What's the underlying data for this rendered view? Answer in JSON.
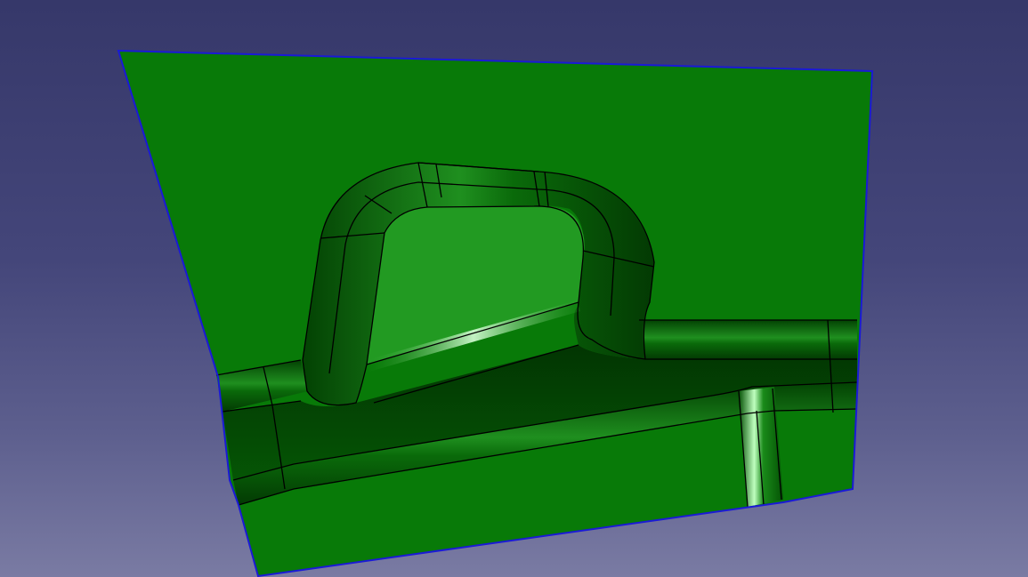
{
  "viewport": {
    "background_top": "#36386a",
    "background_bottom": "#7a7ba3"
  },
  "part": {
    "face_color": "#087a08",
    "deep_face_color": "#044d04",
    "recess_floor_color": "#229a22",
    "highlight_color": "#c8ffc8",
    "edge_color": "#000000",
    "boundary_color": "#1a1ad6"
  }
}
